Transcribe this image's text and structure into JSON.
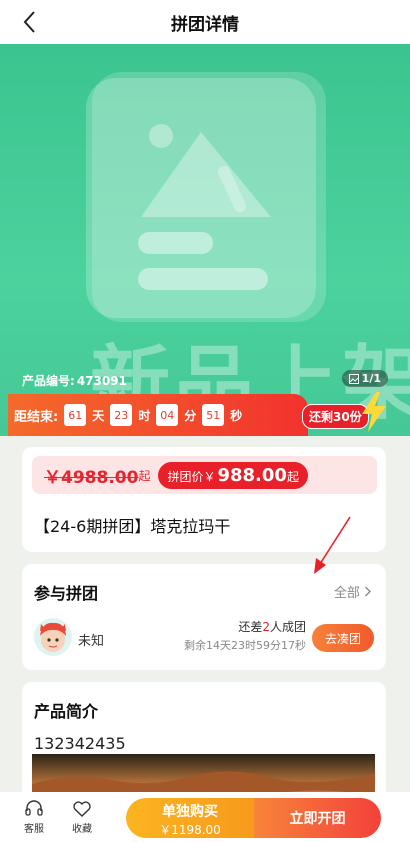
{
  "header": {
    "title": "拼团详情"
  },
  "hero": {
    "bg_text": "新品上架",
    "product_code_label": "产品编号:",
    "product_code": "473091",
    "image_counter": "1/1"
  },
  "countdown": {
    "label": "距结束:",
    "days": "61",
    "days_unit": "天",
    "hours": "23",
    "hours_unit": "时",
    "minutes": "04",
    "minutes_unit": "分",
    "seconds": "51",
    "seconds_unit": "秒",
    "remaining": "还剩30份"
  },
  "price": {
    "original": "￥4988.00",
    "original_suffix": "起",
    "group_label": "拼团价￥",
    "group_amount": "988.00",
    "group_suffix": "起"
  },
  "product": {
    "name": "【24-6期拼团】塔克拉玛干"
  },
  "join": {
    "title": "参与拼团",
    "all_label": "全部",
    "user_name": "未知",
    "lack_prefix": "还差",
    "lack_count": "2",
    "lack_suffix": "人成团",
    "time_left": "剩余14天23时59分17秒",
    "join_button": "去凑团"
  },
  "intro": {
    "title": "产品简介",
    "text": "132342435"
  },
  "bottom": {
    "service_label": "客服",
    "favorite_label": "收藏",
    "solo_label": "单独购买",
    "solo_price": "￥1198.00",
    "open_group_label": "立即开团"
  },
  "colors": {
    "primary_red": "#e8202a",
    "hero_green": "#3cc48f",
    "orange": "#f89a1c"
  }
}
